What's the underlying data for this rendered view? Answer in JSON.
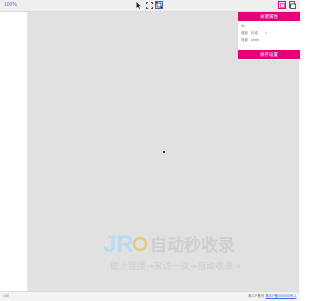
{
  "topbar": {
    "left_label": "100%"
  },
  "tools": [
    {
      "name": "pointer-icon",
      "active": false
    },
    {
      "name": "crop-icon",
      "active": false
    },
    {
      "name": "selection-box-icon",
      "active": true
    }
  ],
  "right_tools": [
    {
      "name": "layer-icon"
    },
    {
      "name": "copy-icon"
    }
  ],
  "props": {
    "header": "关键属性",
    "rows": [
      {
        "label": "ifo",
        "value": ""
      },
      {
        "label": "缩放",
        "value": "标准",
        "extra": "×"
      },
      {
        "label": "背景",
        "value": "white"
      }
    ],
    "button": "保存设置"
  },
  "watermark": {
    "logo_text": "JR",
    "title": "自动秒收录",
    "subtitle": "做上链接→来访一次→自动收录→"
  },
  "bottombar": {
    "left": "100",
    "right_prefix": "粤ICP备号 ",
    "right_link": "粤ICP备000000号-1"
  },
  "colors": {
    "accent": "#e8007a",
    "canvas": "#e1e1e1",
    "link": "#3a6fd8"
  }
}
